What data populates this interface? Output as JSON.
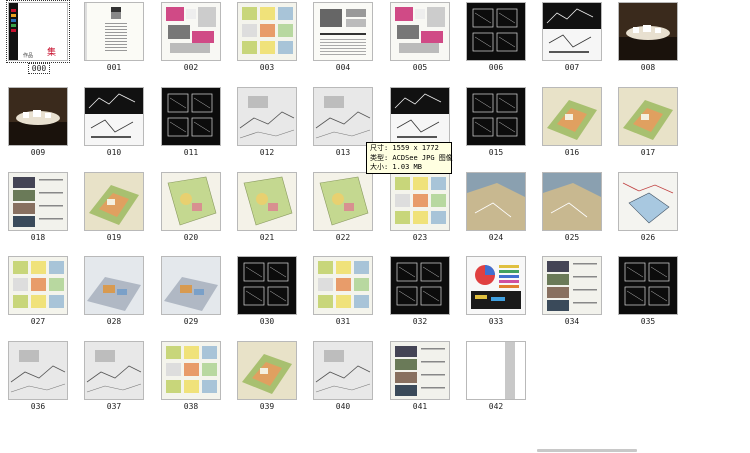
{
  "thumbnails": [
    {
      "label": "000",
      "style": "cover-red",
      "selected": true
    },
    {
      "label": "001",
      "style": "text-page"
    },
    {
      "label": "002",
      "style": "pink-collage"
    },
    {
      "label": "003",
      "style": "diagram-boards"
    },
    {
      "label": "004",
      "style": "text-photos"
    },
    {
      "label": "005",
      "style": "pink-collage"
    },
    {
      "label": "006",
      "style": "black-plans"
    },
    {
      "label": "007",
      "style": "black-section"
    },
    {
      "label": "008",
      "style": "model-dark"
    },
    {
      "label": "009",
      "style": "model-dark"
    },
    {
      "label": "010",
      "style": "black-section"
    },
    {
      "label": "011",
      "style": "black-plans"
    },
    {
      "label": "012",
      "style": "sketch-gray"
    },
    {
      "label": "013",
      "style": "sketch-gray"
    },
    {
      "label": "014",
      "style": "black-section"
    },
    {
      "label": "015",
      "style": "black-plans"
    },
    {
      "label": "016",
      "style": "aerial-green"
    },
    {
      "label": "017",
      "style": "aerial-green"
    },
    {
      "label": "018",
      "style": "photo-strip"
    },
    {
      "label": "019",
      "style": "aerial-green"
    },
    {
      "label": "020",
      "style": "site-plan-green"
    },
    {
      "label": "021",
      "style": "site-plan-green"
    },
    {
      "label": "022",
      "style": "site-plan-green"
    },
    {
      "label": "023",
      "style": "diagram-boards"
    },
    {
      "label": "024",
      "style": "satellite"
    },
    {
      "label": "025",
      "style": "satellite"
    },
    {
      "label": "026",
      "style": "map-line"
    },
    {
      "label": "027",
      "style": "diagram-boards"
    },
    {
      "label": "028",
      "style": "aerial-blue"
    },
    {
      "label": "029",
      "style": "aerial-blue"
    },
    {
      "label": "030",
      "style": "black-plans"
    },
    {
      "label": "031",
      "style": "diagram-boards"
    },
    {
      "label": "032",
      "style": "black-plans"
    },
    {
      "label": "033",
      "style": "chart-colors"
    },
    {
      "label": "034",
      "style": "photo-strip"
    },
    {
      "label": "035",
      "style": "black-plans"
    },
    {
      "label": "036",
      "style": "sketch-gray"
    },
    {
      "label": "037",
      "style": "sketch-gray"
    },
    {
      "label": "038",
      "style": "diagram-boards"
    },
    {
      "label": "039",
      "style": "aerial-green"
    },
    {
      "label": "040",
      "style": "sketch-gray"
    },
    {
      "label": "041",
      "style": "photo-strip"
    },
    {
      "label": "042",
      "style": "blank-stripe"
    }
  ],
  "tooltip": {
    "line1": "尺寸: 1559 x 1772",
    "line2": "类型: ACDSee JPG 图像",
    "line3": "大小: 1.03 MB"
  },
  "cover_text": "作品集",
  "colors": {
    "tooltip_bg": "#ffffe1",
    "border": "#b9b9b9",
    "cover_red": "#c8102e"
  }
}
